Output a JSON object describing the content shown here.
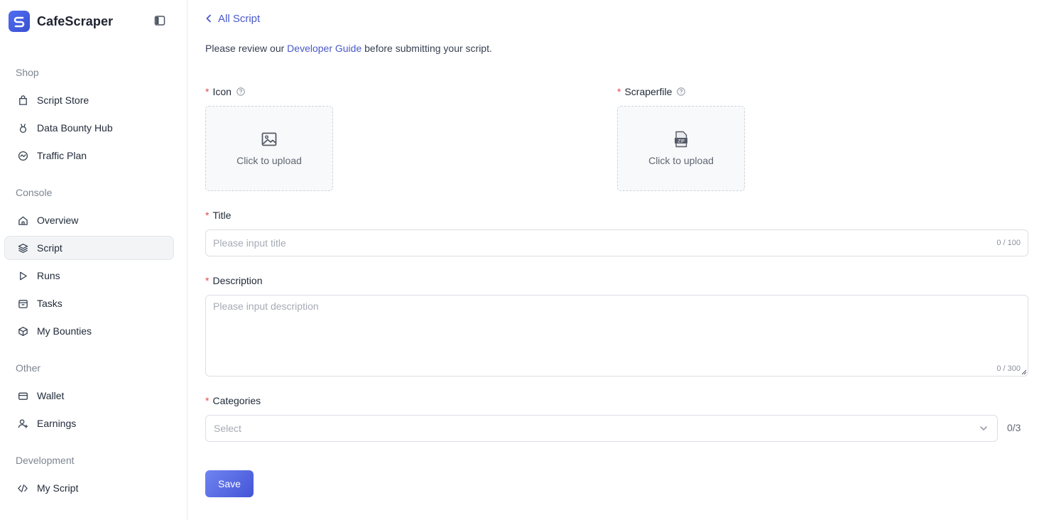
{
  "brand": {
    "name": "CafeScraper",
    "logo_letter": "S"
  },
  "sidebar": {
    "sections": [
      {
        "label": "Shop",
        "items": [
          {
            "label": "Script Store",
            "icon": "shopping-bag-icon"
          },
          {
            "label": "Data Bounty Hub",
            "icon": "medal-icon"
          },
          {
            "label": "Traffic Plan",
            "icon": "traffic-icon"
          }
        ]
      },
      {
        "label": "Console",
        "items": [
          {
            "label": "Overview",
            "icon": "home-icon"
          },
          {
            "label": "Script",
            "icon": "layers-icon",
            "active": true
          },
          {
            "label": "Runs",
            "icon": "play-icon"
          },
          {
            "label": "Tasks",
            "icon": "calendar-icon"
          },
          {
            "label": "My Bounties",
            "icon": "cube-icon"
          }
        ]
      },
      {
        "label": "Other",
        "items": [
          {
            "label": "Wallet",
            "icon": "wallet-icon"
          },
          {
            "label": "Earnings",
            "icon": "user-plus-icon"
          }
        ]
      },
      {
        "label": "Development",
        "items": [
          {
            "label": "My Script",
            "icon": "code-icon"
          }
        ]
      }
    ]
  },
  "main": {
    "back_label": "All Script",
    "intro_prefix": "Please review our ",
    "intro_link": "Developer Guide",
    "intro_suffix": " before submitting your script.",
    "required_mark": "*",
    "icon_field": {
      "label": "Icon",
      "upload_text": "Click to upload"
    },
    "scraperfile_field": {
      "label": "Scraperfile",
      "upload_text": "Click to upload"
    },
    "title_field": {
      "label": "Title",
      "placeholder": "Please input title",
      "counter": "0 / 100"
    },
    "description_field": {
      "label": "Description",
      "placeholder": "Please input description",
      "counter": "0 / 300"
    },
    "categories_field": {
      "label": "Categories",
      "placeholder": "Select",
      "count": "0/3"
    },
    "save_label": "Save"
  },
  "colors": {
    "accent": "#4a59c9",
    "required": "#e5484d",
    "button": "#5568e0"
  }
}
